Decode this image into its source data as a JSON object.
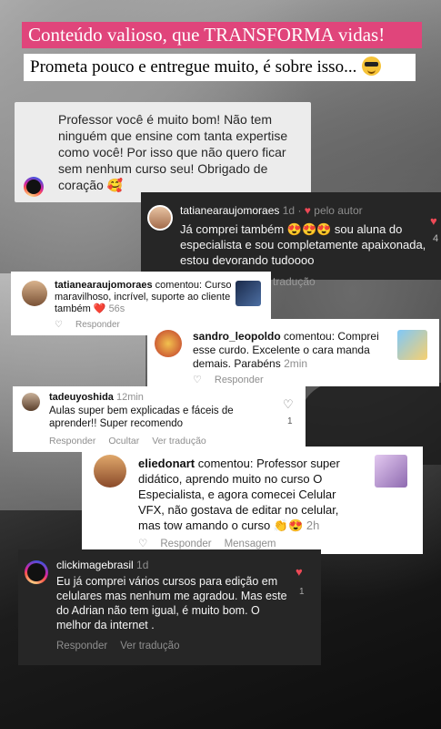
{
  "banner": {
    "pink_text": "Conteúdo valioso, que TRANSFORMA vidas!",
    "white_text": "Prometa pouco e entregue muito, é sobre isso..."
  },
  "card1": {
    "message": "Professor você é muito bom! Não tem ninguém que ensine com tanta expertise como você! Por isso que não quero ficar sem nenhum curso seu! Obrigado de coração 🥰"
  },
  "card2": {
    "username": "tatianearaujomoraes",
    "time": "1d",
    "author_tag": "pelo autor",
    "text": "Já comprei também 😍😍😍 sou aluna do especialista e sou completamente apaixonada, estou devorando tudoooo",
    "translate": "tradução",
    "count": "4"
  },
  "card3": {
    "username": "tatianearaujomoraes",
    "action": "comentou:",
    "text": "Curso maravilhoso, incrível, suporte ao cliente também ❤️",
    "time": "56s",
    "reply": "Responder"
  },
  "card4": {
    "username": "sandro_leopoldo",
    "action": "comentou:",
    "text": "Comprei esse curdo. Excelente o cara manda demais. Parabéns",
    "time": "2min",
    "reply": "Responder"
  },
  "card5": {
    "username": "tadeuyoshida",
    "time": "12min",
    "text": "Aulas super bem explicadas e fáceis de aprender!! Super recomendo",
    "reply": "Responder",
    "hide": "Ocultar",
    "translate": "Ver tradução",
    "count": "1"
  },
  "card6": {
    "username": "eliedonart",
    "action": "comentou:",
    "text": "Professor super didático, aprendo muito no curso O Especialista, e agora comecei Celular VFX, não gostava de editar no celular, mas tow amando o curso 👏😍",
    "time": "2h",
    "reply": "Responder",
    "message": "Mensagem"
  },
  "card7": {
    "username": "clickimagebrasil",
    "time": "1d",
    "text": "Eu já comprei vários cursos para edição em celulares mas nenhum me agradou. Mas este do Adrian não tem igual, é muito bom. O melhor da internet .",
    "reply": "Responder",
    "translate": "Ver tradução",
    "count": "1"
  }
}
